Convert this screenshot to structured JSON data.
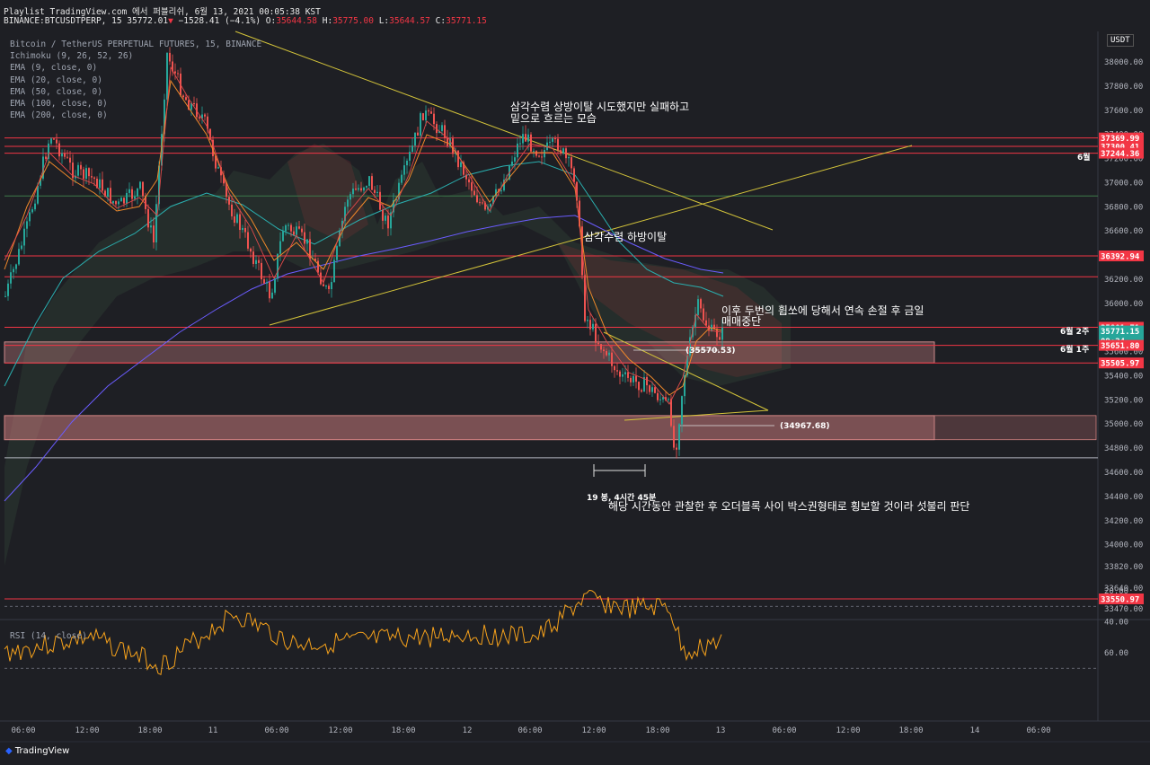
{
  "header": {
    "line1_prefix": "Playlist TradingView.com 에서 퍼블리쉬, 6월 13, 2021 00:05:38 KST",
    "symbol": "BINANCE:BTCUSDTPERP, 15",
    "last": "35772.01",
    "change": "−1528.41 (−4.1%)",
    "o_label": "O:",
    "o": "35644.58",
    "h_label": "H:",
    "h": "35775.00",
    "l_label": "L:",
    "l": "35644.57",
    "c_label": "C:",
    "c": "35771.15"
  },
  "legend": [
    "Bitcoin / TetherUS PERPETUAL FUTURES, 15, BINANCE",
    "Ichimoku (9, 26, 52, 26)",
    "EMA (9, close, 0)",
    "EMA (20, close, 0)",
    "EMA (50, close, 0)",
    "EMA (100, close, 0)",
    "EMA (200, close, 0)"
  ],
  "currency": "USDT",
  "annotations": {
    "triangle_fail_1": "삼각수렴 상방이탈 시도했지만 실패하고",
    "triangle_fail_2": "밑으로 흐르는 모습",
    "triangle_break": "삼각수렴 하방이탈",
    "stop_1": "이후 두번의 휩쏘에 당해서 연속 손절 후 금일",
    "stop_2": "매매중단",
    "candles": "19 봉, 4시간 45분",
    "conclusion": "해당 시간동안 관찰한 후 오더블록 사이 박스권형태로 횡보할 것이라 섯불리 판단",
    "june": "6월",
    "june_w2": "6월 2주",
    "june_w1": "6월 1주",
    "level_a": "(35570.53)",
    "level_b": "(34967.68)",
    "rsi": "RSI (14, close)"
  },
  "chart_data": {
    "type": "candlestick",
    "y_axis_ticks": [
      38000,
      37800,
      37600,
      37400,
      37200,
      37000,
      36800,
      36600,
      36400,
      36200,
      36000,
      35800,
      35600,
      35400,
      35200,
      35000,
      34800,
      34600,
      34400,
      34200,
      34000,
      33820,
      33640,
      33470
    ],
    "x_axis_ticks": [
      "06:00",
      "12:00",
      "18:00",
      "11",
      "06:00",
      "12:00",
      "18:00",
      "12",
      "06:00",
      "12:00",
      "18:00",
      "13",
      "06:00",
      "12:00",
      "18:00",
      "14",
      "06:00"
    ],
    "price_labels": [
      {
        "text": "37369.99",
        "value": 37369.99,
        "color": "#f23645"
      },
      {
        "text": "37300.41",
        "value": 37300.41,
        "color": "#f23645"
      },
      {
        "text": "37244.36",
        "value": 37244.36,
        "color": "#f23645"
      },
      {
        "text": "36392.94",
        "value": 36392.94,
        "color": "#f23645"
      },
      {
        "text": "35801.71",
        "value": 35801.71,
        "color": "#f23645"
      },
      {
        "text": "35771.15",
        "value": 35771.15,
        "color": "#26a69a"
      },
      {
        "text": "09:24",
        "value": 35690,
        "color": "#26a69a"
      },
      {
        "text": "35651.80",
        "value": 35651.8,
        "color": "#f23645"
      },
      {
        "text": "35505.97",
        "value": 35505.97,
        "color": "#f23645"
      },
      {
        "text": "33550.97",
        "value": 33550.97,
        "color": "#f23645"
      }
    ],
    "horizontal_levels": [
      37369.99,
      37300.41,
      37244.36,
      36392.94,
      36220,
      35801.71,
      35651.8,
      35505.97,
      34720,
      33550.97
    ],
    "green_level": 36890,
    "zones": [
      {
        "from": 35505.97,
        "to": 35680
      },
      {
        "from": 34870,
        "to": 35070
      }
    ],
    "rsi_ticks": [
      60,
      40,
      20
    ],
    "rsi_bands": [
      70,
      30
    ],
    "colors": {
      "up": "#26a69a",
      "down": "#ef5350",
      "level": "#f23645",
      "trend": "#d4c43a",
      "rsi": "#f7a21b"
    }
  }
}
